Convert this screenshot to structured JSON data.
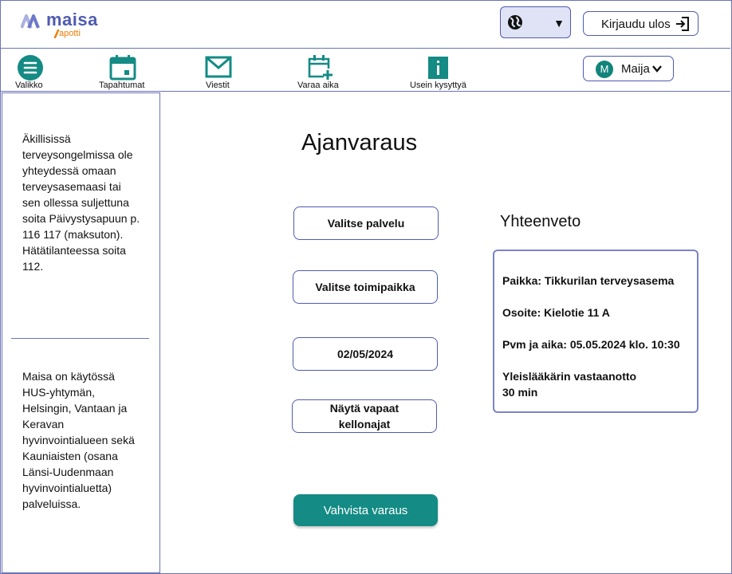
{
  "brand": {
    "name": "maisa",
    "sub": "apotti"
  },
  "topbar": {
    "language_icon": "globe-icon",
    "language_caret": "▼",
    "logout_label": "Kirjaudu ulos",
    "logout_icon": "sign-out-icon"
  },
  "nav": {
    "items": [
      {
        "label": "Valikko",
        "icon": "menu-icon"
      },
      {
        "label": "Tapahtumat",
        "icon": "calendar-icon"
      },
      {
        "label": "Viestit",
        "icon": "mail-icon"
      },
      {
        "label": "Varaa aika",
        "icon": "calendar-add-icon"
      },
      {
        "label": "Usein kysyttyä",
        "icon": "info-icon"
      }
    ],
    "user": {
      "initial": "M",
      "name": "Maija"
    }
  },
  "sidebar": {
    "emergency_text": "Äkillisissä terveysongelmissa ole yhteydessä omaan terveysasemaasi tai sen ollessa suljettuna soita Päivystysapuun p. 116 117 (maksuton). Hätätilanteessa soita 112.",
    "availability_text": "Maisa on käytössä HUS-yhtymän, Helsingin, Vantaan ja Keravan hyvinvointialueen sekä Kauniaisten (osana Länsi-Uudenmaan hyvinvointialuetta) palveluissa."
  },
  "main": {
    "title": "Ajanvaraus",
    "select_service": "Valitse palvelu",
    "select_location": "Valitse toimipaikka",
    "date_value": "02/05/2024",
    "show_times": "Näytä vapaat kellonajat",
    "confirm": "Vahvista varaus"
  },
  "summary": {
    "title": "Yhteenveto",
    "place": "Paikka: Tikkurilan terveysasema",
    "address": "Osoite: Kielotie 11 A",
    "datetime": "Pvm ja aika: 05.05.2024 klo. 10:30",
    "service": "Yleislääkärin vastaanotto",
    "duration": "30 min"
  },
  "colors": {
    "accent": "#148b84",
    "border": "#4f5bb0",
    "brand_orange": "#f07d00"
  }
}
